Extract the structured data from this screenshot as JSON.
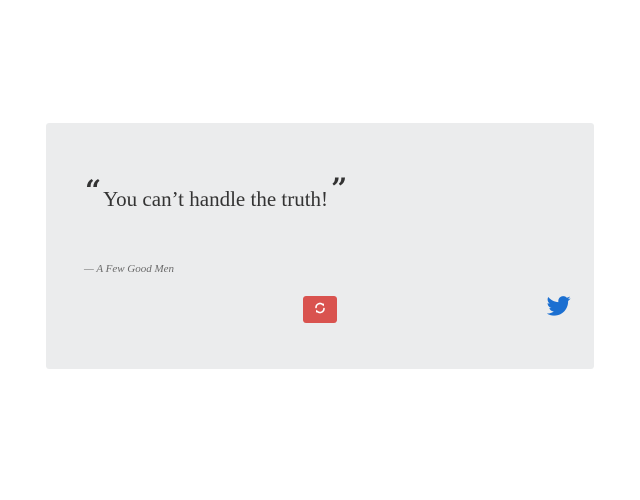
{
  "quote": {
    "open_mark": "“",
    "text": "You can’t handle the truth!",
    "close_mark": "”",
    "source": "— A Few Good Men"
  },
  "actions": {
    "refresh_icon": "refresh-icon",
    "tweet_icon": "twitter-icon"
  },
  "colors": {
    "card_background": "#ebeced",
    "refresh_button": "#d9534f",
    "twitter": "#1b6fd1"
  }
}
